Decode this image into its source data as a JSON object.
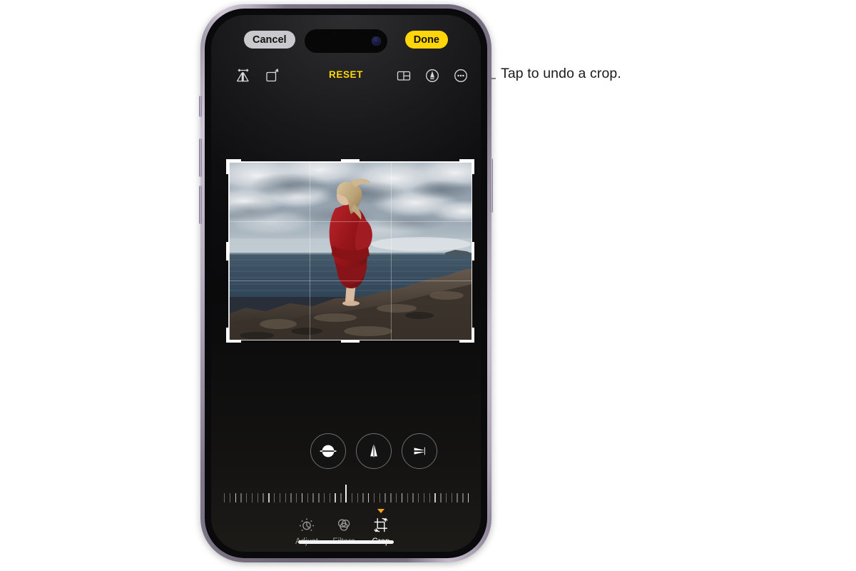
{
  "annotation": {
    "text": "Tap to undo a crop.",
    "target": "reset-button",
    "line_color": "#8c8c8c"
  },
  "device": {
    "name": "iphone",
    "frame_color": "#9b93a5",
    "screen_background": "#0b0b0c"
  },
  "app": {
    "name": "Photos",
    "screen": "photo-editor-crop"
  },
  "topbar": {
    "cancel_label": "Cancel",
    "done_label": "Done",
    "cancel_color": "#c9c9ce",
    "done_color": "#ffd60a"
  },
  "toolbar": {
    "reset_label": "RESET",
    "reset_color": "#ffd60a",
    "items": [
      {
        "name": "flip-icon",
        "label": "Flip"
      },
      {
        "name": "rotate-icon",
        "label": "Rotate"
      },
      {
        "name": "aspect-ratio-icon",
        "label": "Aspect Ratio"
      },
      {
        "name": "markup-icon",
        "label": "Markup"
      },
      {
        "name": "more-options-icon",
        "label": "More Options"
      }
    ]
  },
  "crop": {
    "grid_visible": true,
    "handle_color": "#ffffff",
    "photo_alt": "Person in a red dress standing on coastal rocks by the sea under cloudy sky"
  },
  "perspective": {
    "buttons": [
      {
        "name": "straighten-button",
        "label": "Straighten"
      },
      {
        "name": "vertical-perspective-button",
        "label": "Vertical Perspective"
      },
      {
        "name": "horizontal-perspective-button",
        "label": "Horizontal Perspective"
      }
    ]
  },
  "ruler": {
    "value": 0,
    "tick_count": 45,
    "indicator_color": "#f2f2f2"
  },
  "modes": [
    {
      "name": "adjust",
      "label": "Adjust",
      "active": false
    },
    {
      "name": "filters",
      "label": "Filters",
      "active": false
    },
    {
      "name": "crop",
      "label": "Crop",
      "active": true
    }
  ],
  "caret_color": "#ffa318"
}
